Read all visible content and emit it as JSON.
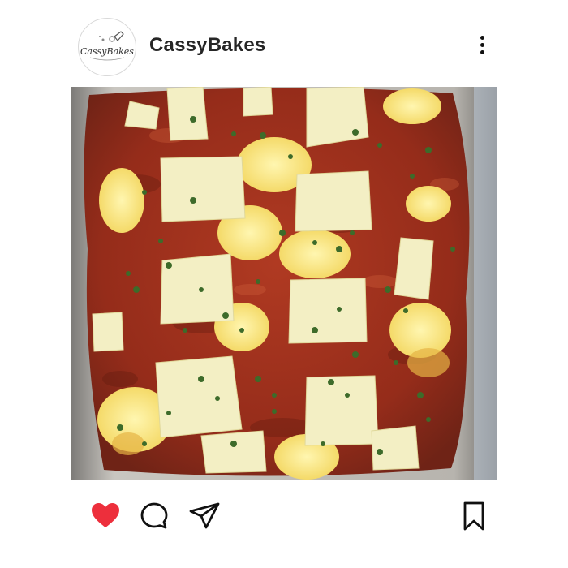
{
  "post": {
    "username": "CassyBakes",
    "avatar_logo_text": "CassyBakes",
    "image_alt": "Baked dish with tomato sauce, melted cheese slices and chopped herbs in a metal pan"
  },
  "actions": {
    "like_icon": "heart-icon",
    "liked": true,
    "like_color": "#ed2f3c",
    "comment_icon": "comment-icon",
    "share_icon": "paper-plane-icon",
    "save_icon": "bookmark-icon",
    "more_icon": "more-vertical-icon"
  }
}
